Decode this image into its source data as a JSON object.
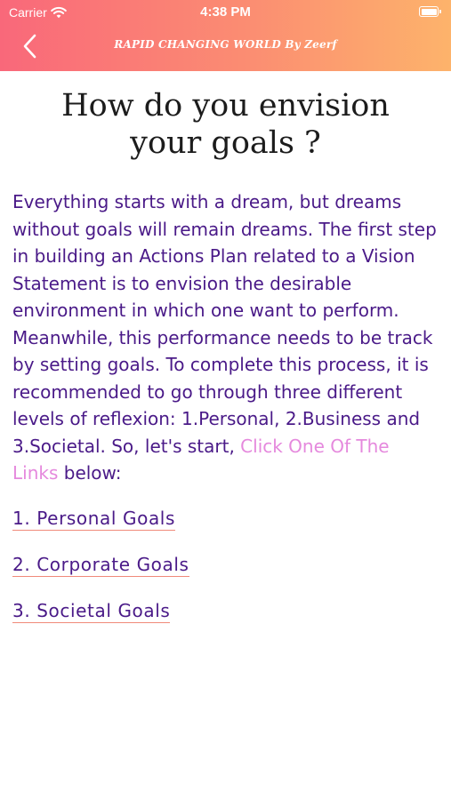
{
  "status_bar": {
    "carrier": "Carrier",
    "time": "4:38 PM"
  },
  "nav": {
    "title": "RAPID CHANGING WORLD By Zeerf",
    "back_icon": "chevron-left-icon"
  },
  "article": {
    "heading": "How do you envision your goals ?",
    "paragraph_before_link": "Everything starts with a dream, but dreams without goals will remain dreams. The first step in building an Actions Plan related to a Vision Statement is to envision the desirable environment in which one want to perform. Meanwhile, this performance needs to be track by setting goals. To complete this process, it is recommended to go through three different levels of reflexion: 1.Personal, 2.Business and 3.Societal. So, let's start, ",
    "inline_link": "Click One Of The Links",
    "paragraph_after_link": " below:"
  },
  "links": [
    {
      "label": "1. Personal Goals"
    },
    {
      "label": "2. Corporate Goals"
    },
    {
      "label": "3. Societal Goals"
    }
  ],
  "colors": {
    "header_gradient_start": "#f9687a",
    "header_gradient_end": "#fdb36b",
    "body_text": "#4a1a88",
    "inline_link": "#e589dd",
    "link_underline": "#f08a7a"
  }
}
